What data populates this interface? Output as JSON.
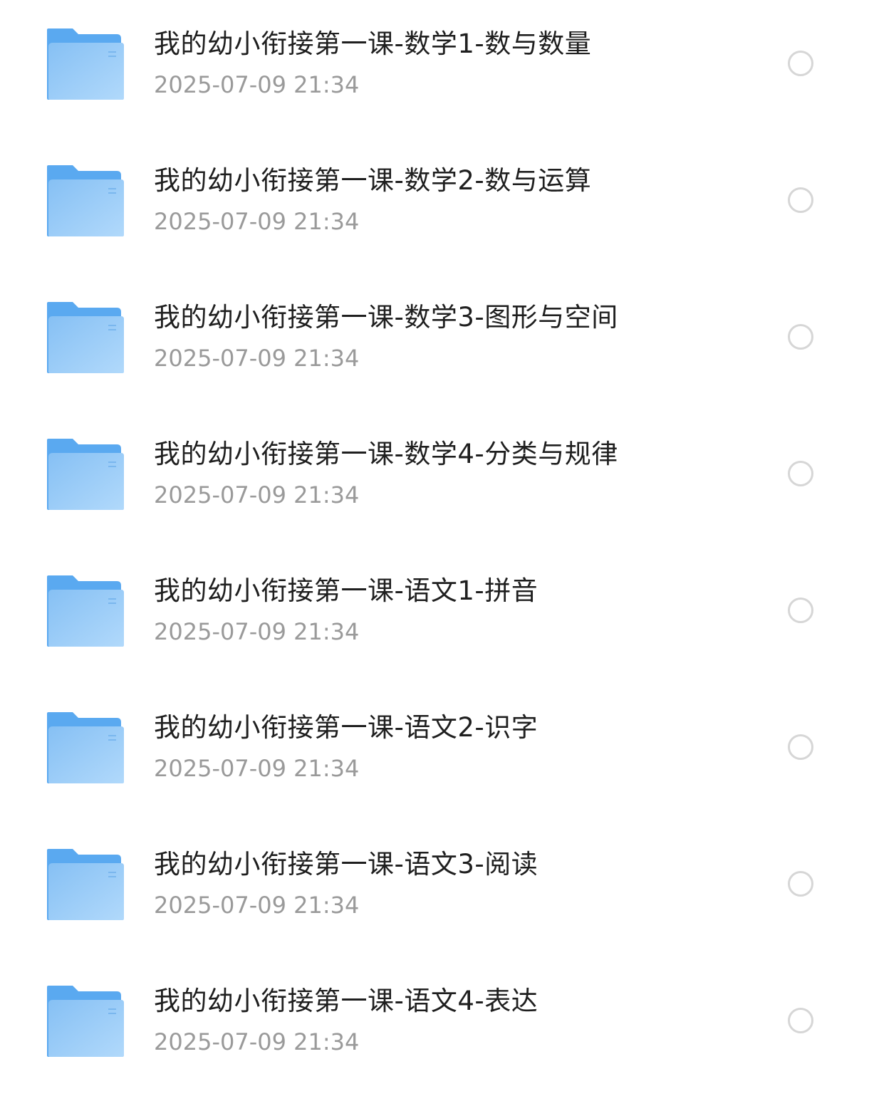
{
  "files": [
    {
      "name": "我的幼小衔接第一课-数学1-数与数量",
      "date": "2025-07-09 21:34",
      "icon": "folder-icon"
    },
    {
      "name": "我的幼小衔接第一课-数学2-数与运算",
      "date": "2025-07-09 21:34",
      "icon": "folder-icon"
    },
    {
      "name": "我的幼小衔接第一课-数学3-图形与空间",
      "date": "2025-07-09 21:34",
      "icon": "folder-icon"
    },
    {
      "name": "我的幼小衔接第一课-数学4-分类与规律",
      "date": "2025-07-09 21:34",
      "icon": "folder-icon"
    },
    {
      "name": "我的幼小衔接第一课-语文1-拼音",
      "date": "2025-07-09 21:34",
      "icon": "folder-icon"
    },
    {
      "name": "我的幼小衔接第一课-语文2-识字",
      "date": "2025-07-09 21:34",
      "icon": "folder-icon"
    },
    {
      "name": "我的幼小衔接第一课-语文3-阅读",
      "date": "2025-07-09 21:34",
      "icon": "folder-icon"
    },
    {
      "name": "我的幼小衔接第一课-语文4-表达",
      "date": "2025-07-09 21:34",
      "icon": "folder-icon"
    }
  ],
  "colors": {
    "folder_back": "#5aa9f0",
    "folder_front_top": "#8cc4f5",
    "folder_front_bottom": "#a9d4fa",
    "title_text": "#1f1f1f",
    "date_text": "#9a9a9a",
    "radio_border": "#d6d6d6"
  }
}
